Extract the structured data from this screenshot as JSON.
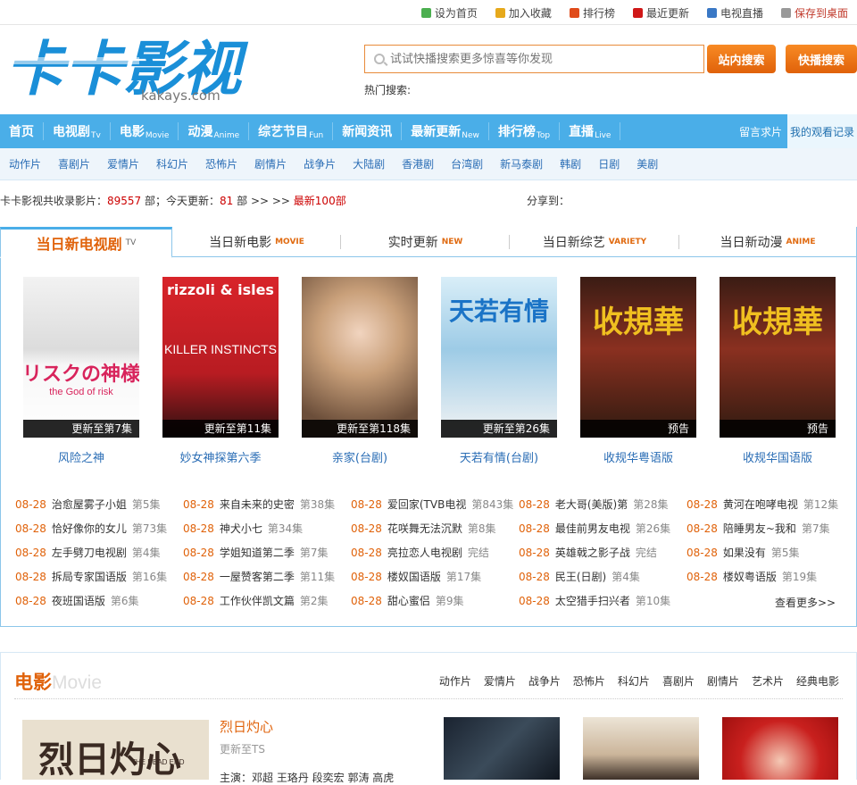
{
  "topbar": {
    "links": [
      {
        "label": "设为首页",
        "icon": "plus-icon",
        "color": "#4caf50"
      },
      {
        "label": "加入收藏",
        "icon": "favorite-icon",
        "color": "#e6a91c"
      },
      {
        "label": "排行榜",
        "icon": "fire-icon",
        "color": "#e04b1a"
      },
      {
        "label": "最近更新",
        "icon": "new-icon",
        "color": "#d01818"
      },
      {
        "label": "电视直播",
        "icon": "tv-icon",
        "color": "#3a78c5"
      },
      {
        "label": "保存到桌面",
        "icon": "page-icon",
        "color": "#999999"
      }
    ]
  },
  "logo": {
    "main": "卡卡影视",
    "domain": "kakays.com"
  },
  "search": {
    "placeholder": "试试快播搜索更多惊喜等你发现",
    "site_btn": "站内搜索",
    "qvod_btn": "快播搜索",
    "hot_label": "热门搜索:"
  },
  "nav": {
    "items": [
      {
        "label": "首页",
        "en": ""
      },
      {
        "label": "电视剧",
        "en": "Tv"
      },
      {
        "label": "电影",
        "en": "Movie"
      },
      {
        "label": "动漫",
        "en": "Anime"
      },
      {
        "label": "综艺节目",
        "en": "Fun"
      },
      {
        "label": "新闻资讯",
        "en": ""
      },
      {
        "label": "最新更新",
        "en": "New"
      },
      {
        "label": "排行榜",
        "en": "Top"
      },
      {
        "label": "直播",
        "en": "Live"
      }
    ],
    "right": [
      "留言求片",
      "我的观看记录"
    ]
  },
  "subnav": [
    "动作片",
    "喜剧片",
    "爱情片",
    "科幻片",
    "恐怖片",
    "剧情片",
    "战争片",
    "大陆剧",
    "香港剧",
    "台湾剧",
    "新马泰剧",
    "韩剧",
    "日剧",
    "美剧"
  ],
  "stats": {
    "prefix": "卡卡影视共收录影片：",
    "total": "89557",
    "mid": " 部；今天更新：",
    "today": "81",
    "suffix": " 部 >> >> ",
    "latest": "最新100部",
    "share": "分享到："
  },
  "tabs": [
    {
      "label": "当日新电视剧",
      "en": "TV"
    },
    {
      "label": "当日新电影",
      "en": "MOVIE"
    },
    {
      "label": "实时更新",
      "en": "NEW"
    },
    {
      "label": "当日新综艺",
      "en": "VARIETY"
    },
    {
      "label": "当日新动漫",
      "en": "ANIME"
    }
  ],
  "posters": [
    {
      "title": "风险之神",
      "badge": "更新至第7集",
      "art": "リスクの神様",
      "art_sub": "the God of risk"
    },
    {
      "title": "妙女神探第六季",
      "badge": "更新至第11集",
      "art": "rizzoli & isles",
      "art_sub": "KILLER INSTINCTS"
    },
    {
      "title": "亲家(台剧)",
      "badge": "更新至第118集",
      "art": "",
      "art_sub": ""
    },
    {
      "title": "天若有情(台剧)",
      "badge": "更新至第26集",
      "art": "天若有情",
      "art_sub": ""
    },
    {
      "title": "收规华粤语版",
      "badge": "预告",
      "art": "收規華",
      "art_sub": ""
    },
    {
      "title": "收规华国语版",
      "badge": "预告",
      "art": "收規華",
      "art_sub": ""
    }
  ],
  "updates": [
    [
      {
        "date": "08-28",
        "title": "治愈屋雾子小姐",
        "ep": "第5集"
      },
      {
        "date": "08-28",
        "title": "恰好像你的女儿",
        "ep": "第73集"
      },
      {
        "date": "08-28",
        "title": "左手劈刀电视剧",
        "ep": "第4集"
      },
      {
        "date": "08-28",
        "title": "拆局专家国语版",
        "ep": "第16集"
      },
      {
        "date": "08-28",
        "title": "夜班国语版",
        "ep": "第6集"
      }
    ],
    [
      {
        "date": "08-28",
        "title": "来自未来的史密",
        "ep": "第38集"
      },
      {
        "date": "08-28",
        "title": "神犬小七",
        "ep": "第34集"
      },
      {
        "date": "08-28",
        "title": "学姐知道第二季",
        "ep": "第7集"
      },
      {
        "date": "08-28",
        "title": "一屋赞客第二季",
        "ep": "第11集"
      },
      {
        "date": "08-28",
        "title": "工作伙伴凯文篇",
        "ep": "第2集"
      }
    ],
    [
      {
        "date": "08-28",
        "title": "爱回家(TVB电视",
        "ep": "第843集"
      },
      {
        "date": "08-28",
        "title": "花咲舞无法沉默",
        "ep": "第8集"
      },
      {
        "date": "08-28",
        "title": "亮拉恋人电视剧",
        "ep": "完结"
      },
      {
        "date": "08-28",
        "title": "楼奴国语版",
        "ep": "第17集"
      },
      {
        "date": "08-28",
        "title": "甜心蜜侣",
        "ep": "第9集"
      }
    ],
    [
      {
        "date": "08-28",
        "title": "老大哥(美版)第",
        "ep": "第28集"
      },
      {
        "date": "08-28",
        "title": "最佳前男友电视",
        "ep": "第26集"
      },
      {
        "date": "08-28",
        "title": "英雄戟之影子战",
        "ep": "完结"
      },
      {
        "date": "08-28",
        "title": "民王(日剧)",
        "ep": "第4集"
      },
      {
        "date": "08-28",
        "title": "太空猎手扫兴者",
        "ep": "第10集"
      }
    ],
    [
      {
        "date": "08-28",
        "title": "黄河在咆哮电视",
        "ep": "第12集"
      },
      {
        "date": "08-28",
        "title": "陪睡男友~我和",
        "ep": "第7集"
      },
      {
        "date": "08-28",
        "title": "如果没有",
        "ep": "第5集"
      },
      {
        "date": "08-28",
        "title": "楼奴粤语版",
        "ep": "第19集"
      }
    ]
  ],
  "more": "查看更多>>",
  "movie": {
    "title": "电影",
    "en": "Movie",
    "cats": [
      "动作片",
      "爱情片",
      "战争片",
      "恐怖片",
      "科幻片",
      "喜剧片",
      "剧情片",
      "艺术片",
      "经典电影"
    ],
    "feature_title": "烈日灼心",
    "feature_sub": "更新至TS",
    "feature_cast": "主演：邓超 王珞丹 段奕宏 郭涛 高虎",
    "feature_art": "烈日灼心",
    "feature_art_en": "THE DEAD END"
  }
}
